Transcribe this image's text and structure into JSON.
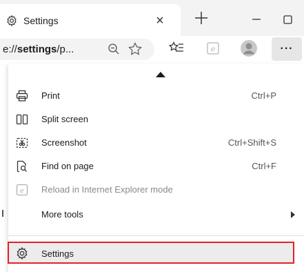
{
  "tab": {
    "title": "Settings",
    "close_glyph": "×",
    "icon": "gear-icon"
  },
  "window": {
    "newtab_glyph": "+",
    "minimize_icon": "minimize-icon",
    "maximize_icon": "maximize-icon"
  },
  "address": {
    "prefix": "e://",
    "bold": "settings",
    "suffix": "/p..."
  },
  "toolbar": {
    "more_glyph": "···"
  },
  "menu": {
    "items": [
      {
        "label": "Print",
        "shortcut": "Ctrl+P",
        "icon": "print-icon"
      },
      {
        "label": "Split screen",
        "shortcut": "",
        "icon": "split-screen-icon"
      },
      {
        "label": "Screenshot",
        "shortcut": "Ctrl+Shift+S",
        "icon": "screenshot-icon"
      },
      {
        "label": "Find on page",
        "shortcut": "Ctrl+F",
        "icon": "find-on-page-icon"
      },
      {
        "label": "Reload in Internet Explorer mode",
        "shortcut": "",
        "icon": "ie-mode-icon",
        "disabled": true
      },
      {
        "label": "More tools",
        "shortcut": "",
        "icon": "",
        "submenu": true
      }
    ],
    "settings": {
      "label": "Settings",
      "icon": "gear-icon"
    }
  },
  "colors": {
    "highlight_border": "#e0212b",
    "more_button_bg": "#e6e6e6"
  }
}
